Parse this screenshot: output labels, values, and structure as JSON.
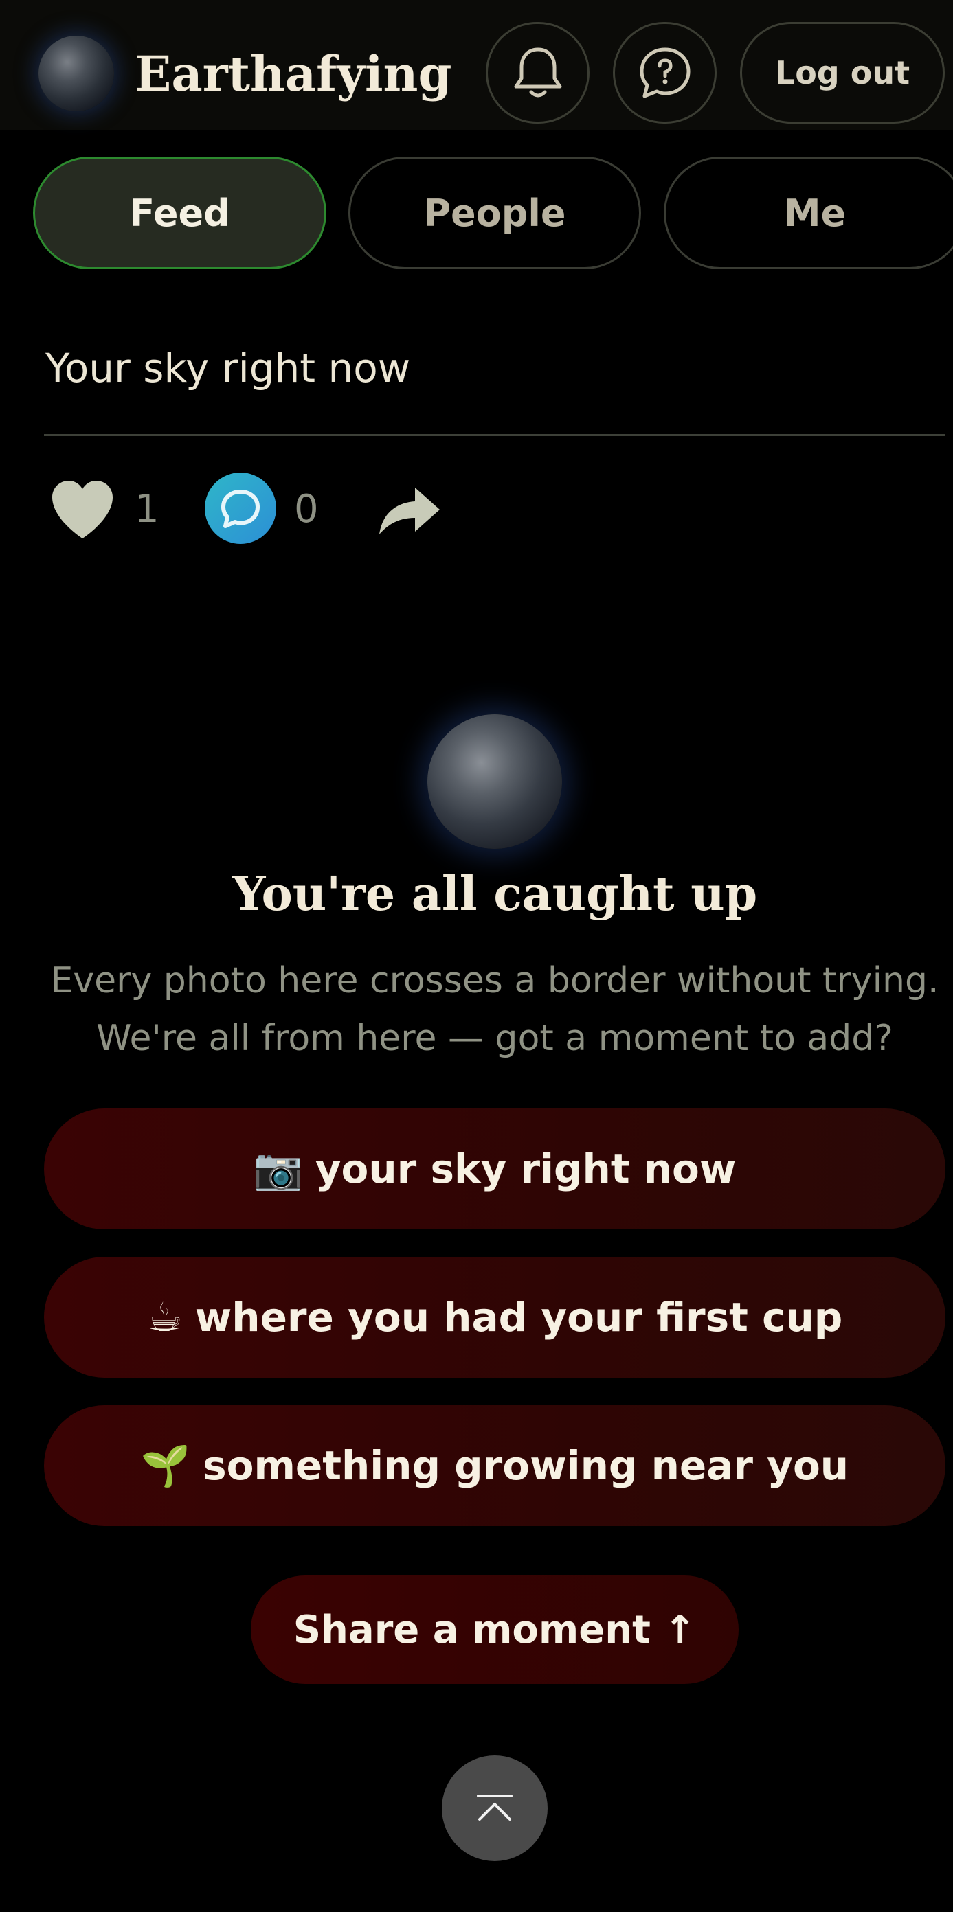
{
  "header": {
    "brand": "Earthafying",
    "logout_label": "Log out",
    "icons": [
      "globe-logo",
      "bell-icon",
      "chat-question-icon"
    ]
  },
  "tabs": [
    {
      "label": "Feed",
      "active": true
    },
    {
      "label": "People",
      "active": false
    },
    {
      "label": "Me",
      "active": false
    }
  ],
  "post": {
    "text": "Your sky right now",
    "likes": "1",
    "comments": "0",
    "icons": [
      "heart-icon",
      "comment-icon",
      "share-arrow-icon"
    ]
  },
  "caught_up": {
    "title": "You're all caught up",
    "subtitle_line1": "Every photo here crosses a border without trying.",
    "subtitle_line2": "We're all from here — got a moment to add?"
  },
  "prompts": [
    {
      "emoji": "📷",
      "label": "your sky right now"
    },
    {
      "emoji": "☕",
      "label": "where you had your first cup"
    },
    {
      "emoji": "🌱",
      "label": "something growing near you"
    }
  ],
  "share_button": "Share a moment ↑",
  "colors": {
    "accent_green": "#2d8a2f",
    "button_red": "#3a0304",
    "comment_blue": "#2c8fd6",
    "text_cream": "#f2ead8"
  }
}
